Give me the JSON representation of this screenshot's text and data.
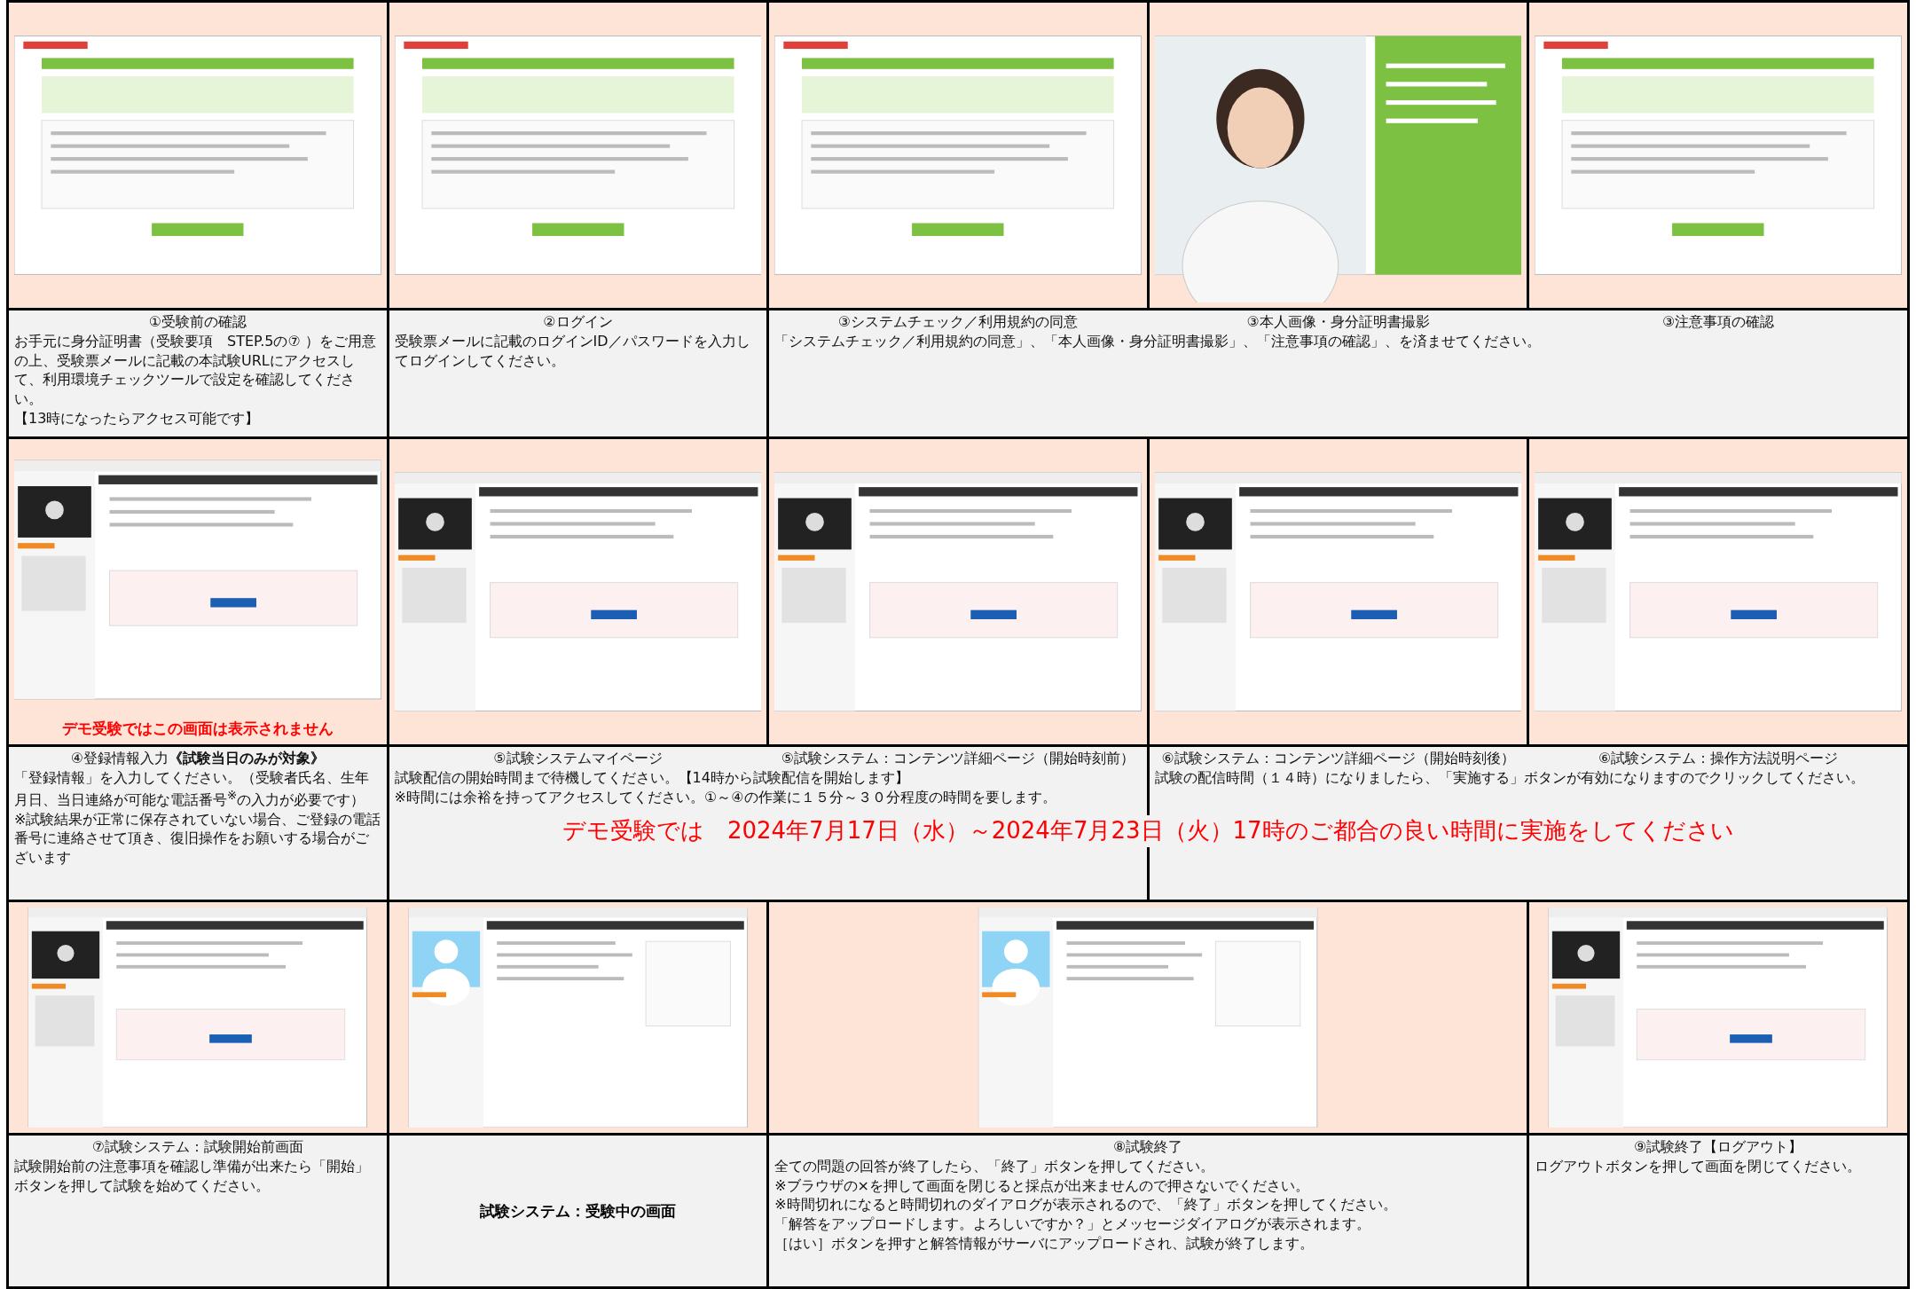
{
  "rows": [
    {
      "screens": [
        {
          "kind": "green",
          "wide": false
        },
        {
          "kind": "green",
          "wide": false
        },
        {
          "kind": "green",
          "wide": false
        },
        {
          "kind": "photo",
          "wide": false
        },
        {
          "kind": "green",
          "wide": false
        }
      ],
      "cells": [
        {
          "kind": "normal",
          "titles": [
            "①受験前の確認"
          ],
          "bodies": [
            [
              "お手元に身分証明書（受験要項　STEP.5の⑦ ）をご用意の上、受験票メールに記載の本試験URLにアクセスして、利用環境チェックツールで設定を確認してください。",
              "【13時になったらアクセス可能です】"
            ]
          ]
        },
        {
          "kind": "normal",
          "titles": [
            "②ログイン"
          ],
          "bodies": [
            [
              "受験票メールに記載のログインID／パスワードを入力してログインしてください。"
            ]
          ]
        },
        {
          "kind": "normal",
          "titles": [
            "③システムチェック／利用規約の同意",
            "③本人画像・身分証明書撮影",
            "③注意事項の確認"
          ],
          "bodies": [
            [
              "「システムチェック／利用規約の同意」、「本人画像・身分証明書撮影」、「注意事項の確認」、を済ませてください。"
            ]
          ]
        }
      ]
    },
    {
      "screens": [
        {
          "kind": "dark",
          "wide": false,
          "caption": "デモ受験ではこの画面は表示されません"
        },
        {
          "kind": "dark",
          "wide": false
        },
        {
          "kind": "dark",
          "wide": false
        },
        {
          "kind": "dark",
          "wide": false
        },
        {
          "kind": "dark",
          "wide": false
        }
      ],
      "cells": [
        {
          "kind": "normal",
          "titles": [
            "④登録情報入力**《試験当日のみが対象》**"
          ],
          "bodies": [
            [
              "「登録情報」を入力してください。（受験者氏名、生年月日、当日連絡が可能な電話番号$^{※}$の入力が必要です）",
              "※試験結果が正常に保存されていない場合、ご登録の電話番号に連絡させて頂き、復旧操作をお願いする場合がございます"
            ]
          ]
        },
        {
          "kind": "normal",
          "titles": [
            "⑤試験システムマイページ",
            "⑤試験システム：コンテンツ詳細ページ（開始時刻前）",
            "⑥試験システム：コンテンツ詳細ページ（開始時刻後）",
            "⑥試験システム：操作方法説明ページ"
          ],
          "bodies": [
            [
              "試験配信の開始時間まで待機してください。【14時から試験配信を開始します】",
              "※時間には余裕を持ってアクセスしてください。①～④の作業に１５分～３０分程度の時間を要します。"
            ],
            [
              "試験の配信時間（１４時）になりましたら、「実施する」ボタンが有効になりますのでクリックしてください。"
            ]
          ],
          "banner": "デモ受験では　2024年7月17日（水）～2024年7月23日（火）17時のご都合の良い時間に実施をしてください"
        }
      ]
    },
    {
      "screens": [
        {
          "kind": "dark",
          "wide": false
        },
        {
          "kind": "avatar",
          "wide": false
        },
        {
          "kind": "avatar",
          "wide": true
        },
        {
          "kind": "dark",
          "wide": false
        }
      ],
      "cells": [
        {
          "kind": "normal",
          "titles": [
            "⑦試験システム：試験開始前画面"
          ],
          "bodies": [
            [
              "試験開始前の注意事項を確認し準備が出来たら「開始」ボタンを押して試験を始めてください。"
            ]
          ]
        },
        {
          "kind": "note",
          "note": "試験システム：受験中の画面"
        },
        {
          "kind": "wide",
          "titles": [
            "⑧試験終了"
          ],
          "bodies": [
            [
              "全ての問題の回答が終了したら、「終了」ボタンを押してください。",
              "※ブラウザの×を押して画面を閉じると採点が出来ませんので押さないでください。",
              "※時間切れになると時間切れのダイアログが表示されるので、「終了」ボタンを押してください。",
              "「解答をアップロードします。よろしいですか？」とメッセージダイアログが表示されます。",
              "［はい］ボタンを押すと解答情報がサーバにアップロードされ、試験が終了します。"
            ]
          ]
        },
        {
          "kind": "normal",
          "titles": [
            "⑨試験終了【ログアウト】"
          ],
          "bodies": [
            [
              "ログアウトボタンを押して画面を閉じてください。"
            ]
          ]
        }
      ]
    }
  ]
}
